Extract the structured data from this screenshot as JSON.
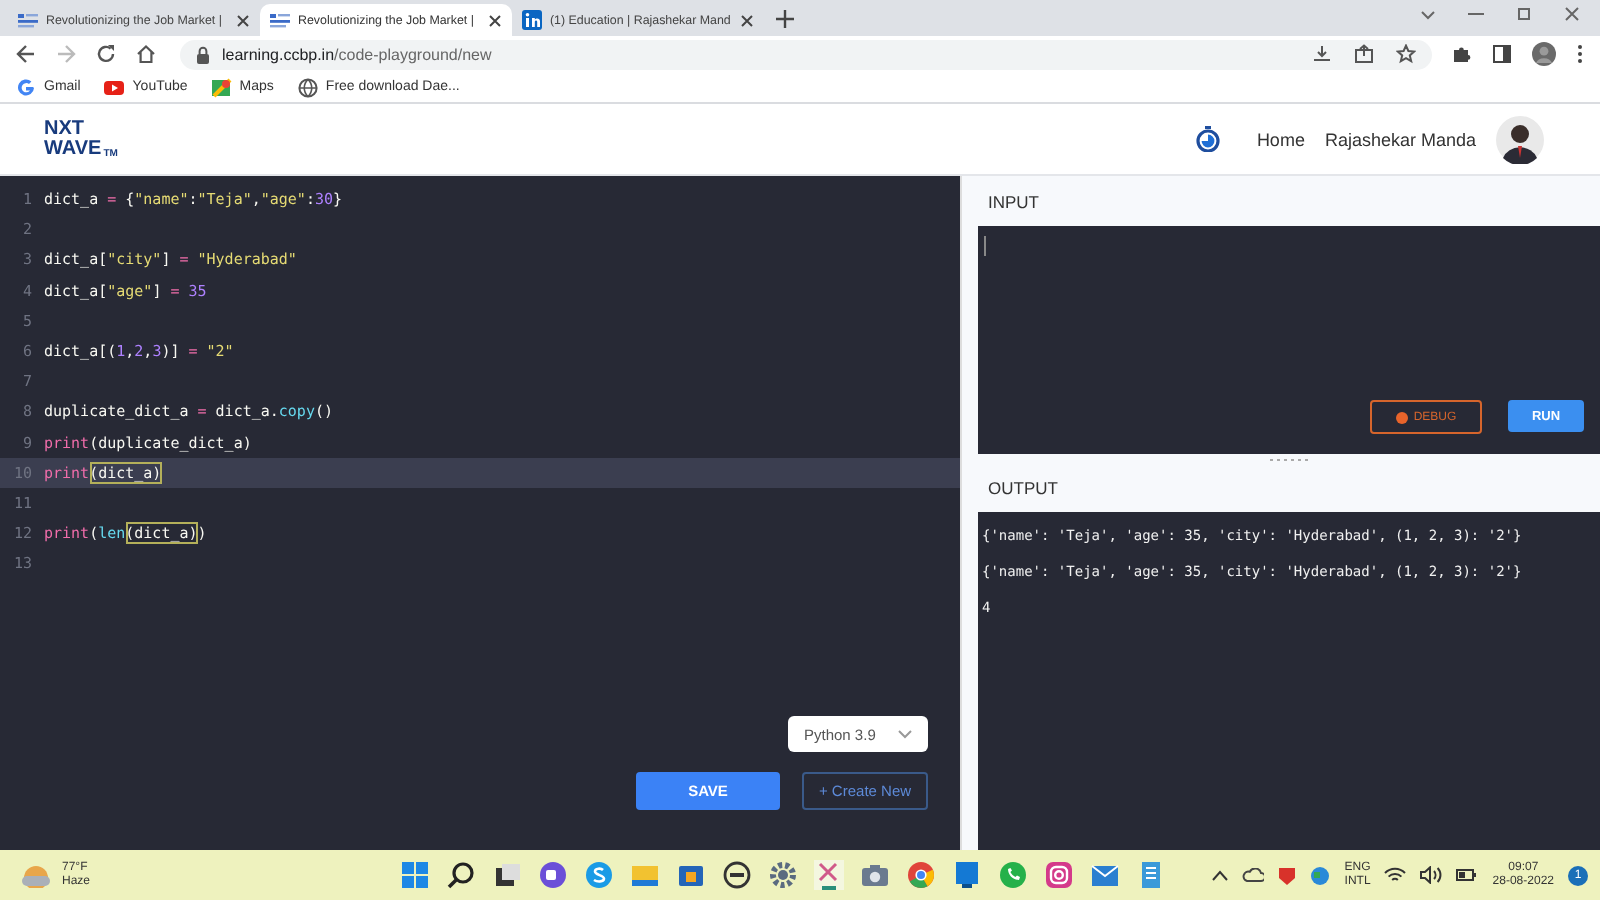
{
  "browser": {
    "tabs": [
      {
        "title": "Revolutionizing the Job Market |",
        "selected": false
      },
      {
        "title": "Revolutionizing the Job Market |",
        "selected": true
      },
      {
        "title": "(1) Education | Rajashekar Mand",
        "selected": false
      }
    ],
    "url_host": "learning.ccbp.in",
    "url_path": "/code-playground/new",
    "bookmarks": [
      "Gmail",
      "YouTube",
      "Maps",
      "Free download Dae..."
    ]
  },
  "header": {
    "logo_top": "NXT",
    "logo_bottom": "WAVE",
    "logo_mark": "TM",
    "nav": [
      "Home"
    ],
    "user": "Rajashekar Manda"
  },
  "editor": {
    "lines": [
      {
        "number": "1",
        "current": false,
        "tokens": [
          {
            "kind": "plain",
            "text": "dict_a "
          },
          {
            "kind": "op",
            "text": "= "
          },
          {
            "kind": "plain",
            "text": "{"
          },
          {
            "kind": "string",
            "text": "\"name\""
          },
          {
            "kind": "plain",
            "text": ":"
          },
          {
            "kind": "string",
            "text": "\"Teja\""
          },
          {
            "kind": "plain",
            "text": ","
          },
          {
            "kind": "string",
            "text": "\"age\""
          },
          {
            "kind": "plain",
            "text": ":"
          },
          {
            "kind": "number",
            "text": "30"
          },
          {
            "kind": "plain",
            "text": "}"
          }
        ]
      },
      {
        "number": "2",
        "current": false
      },
      {
        "number": "3",
        "current": false,
        "tokens": [
          {
            "kind": "plain",
            "text": "dict_a["
          },
          {
            "kind": "string",
            "text": "\"city\""
          },
          {
            "kind": "plain",
            "text": "] "
          },
          {
            "kind": "op",
            "text": "= "
          },
          {
            "kind": "string",
            "text": "\"Hyderabad\""
          }
        ]
      },
      {
        "number": "4",
        "current": false,
        "tokens": [
          {
            "kind": "plain",
            "text": "dict_a["
          },
          {
            "kind": "string",
            "text": "\"age\""
          },
          {
            "kind": "plain",
            "text": "] "
          },
          {
            "kind": "op",
            "text": "= "
          },
          {
            "kind": "number",
            "text": "35"
          }
        ]
      },
      {
        "number": "5",
        "current": false
      },
      {
        "number": "6",
        "current": false,
        "tokens": [
          {
            "kind": "plain",
            "text": "dict_a[("
          },
          {
            "kind": "number",
            "text": "1"
          },
          {
            "kind": "plain",
            "text": ","
          },
          {
            "kind": "number",
            "text": "2"
          },
          {
            "kind": "plain",
            "text": ","
          },
          {
            "kind": "number",
            "text": "3"
          },
          {
            "kind": "plain",
            "text": ")] "
          },
          {
            "kind": "op",
            "text": "= "
          },
          {
            "kind": "string",
            "text": "\"2\""
          }
        ]
      },
      {
        "number": "7",
        "current": false
      },
      {
        "number": "8",
        "current": false,
        "tokens": [
          {
            "kind": "plain",
            "text": "duplicate_dict_a "
          },
          {
            "kind": "op",
            "text": "= "
          },
          {
            "kind": "plain",
            "text": "dict_a."
          },
          {
            "kind": "builtin",
            "text": "copy"
          },
          {
            "kind": "plain",
            "text": "()"
          }
        ]
      },
      {
        "number": "9",
        "current": false,
        "tokens": [
          {
            "kind": "keyword",
            "text": "print"
          },
          {
            "kind": "plain",
            "text": "(duplicate_dict_a)"
          }
        ]
      },
      {
        "number": "10",
        "current": true,
        "tokens": [
          {
            "kind": "keyword",
            "text": "print"
          },
          {
            "kind": "match",
            "text": "(dict_a)"
          }
        ]
      },
      {
        "number": "11",
        "current": false
      },
      {
        "number": "12",
        "current": false,
        "tokens": [
          {
            "kind": "keyword",
            "text": "print"
          },
          {
            "kind": "plain",
            "text": "("
          },
          {
            "kind": "builtin",
            "text": "len"
          },
          {
            "kind": "match",
            "text": "(dict_a)"
          },
          {
            "kind": "plain",
            "text": ")"
          }
        ]
      },
      {
        "number": "13",
        "current": false
      }
    ],
    "language": "Python 3.9",
    "save": "SAVE",
    "create_new": "+ Create New"
  },
  "input": {
    "label": "INPUT",
    "debug": "DEBUG",
    "run": "RUN"
  },
  "output": {
    "label": "OUTPUT",
    "lines": [
      "{'name': 'Teja', 'age': 35, 'city': 'Hyderabad', (1, 2, 3): '2'}",
      "{'name': 'Teja', 'age': 35, 'city': 'Hyderabad', (1, 2, 3): '2'}",
      "4"
    ]
  },
  "taskbar": {
    "temperature": "77°F",
    "weather": "Haze",
    "lang_top": "ENG",
    "lang_bottom": "INTL",
    "time": "09:07",
    "date": "28-08-2022",
    "notifications": "1"
  }
}
